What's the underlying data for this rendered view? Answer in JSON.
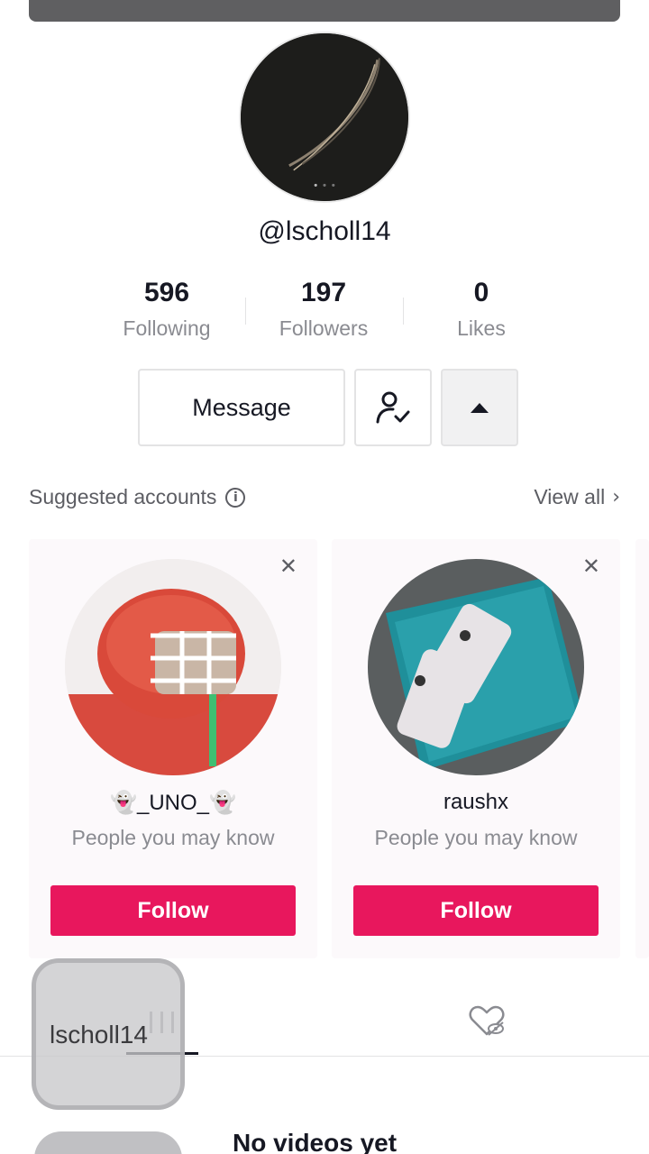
{
  "profile": {
    "username": "@lscholl14",
    "stats": [
      {
        "value": "596",
        "label": "Following"
      },
      {
        "value": "197",
        "label": "Followers"
      },
      {
        "value": "0",
        "label": "Likes"
      }
    ],
    "message_label": "Message"
  },
  "suggested": {
    "title": "Suggested accounts",
    "view_all": "View all",
    "cards": [
      {
        "name": "👻_UNO_👻",
        "subtitle": "People you may know",
        "follow_label": "Follow"
      },
      {
        "name": "raushx",
        "subtitle": "People you may know",
        "follow_label": "Follow"
      }
    ]
  },
  "overlay": {
    "label": "lscholl14"
  },
  "empty_state": {
    "title": "No videos yet"
  },
  "icons": {
    "info": "info-icon",
    "chevron": "chevron-right-icon",
    "close": "close-icon",
    "friend": "friend-check-icon",
    "more": "caret-up-icon",
    "videos": "grid-icon",
    "liked": "liked-hidden-icon"
  },
  "colors": {
    "accent": "#e8175d",
    "text": "#161823",
    "muted": "#8a8b91"
  }
}
